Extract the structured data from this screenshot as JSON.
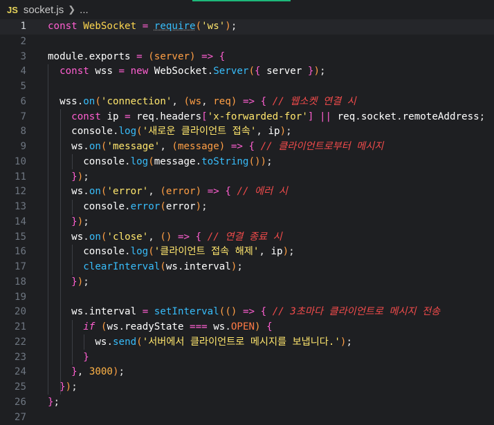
{
  "breadcrumb": {
    "lang_badge": "JS",
    "file": "socket.js",
    "tail": "..."
  },
  "lines": [
    {
      "n": "1"
    },
    {
      "n": "2"
    },
    {
      "n": "3"
    },
    {
      "n": "4"
    },
    {
      "n": "5"
    },
    {
      "n": "6"
    },
    {
      "n": "7"
    },
    {
      "n": "8"
    },
    {
      "n": "9"
    },
    {
      "n": "10"
    },
    {
      "n": "11"
    },
    {
      "n": "12"
    },
    {
      "n": "13"
    },
    {
      "n": "14"
    },
    {
      "n": "15"
    },
    {
      "n": "16"
    },
    {
      "n": "17"
    },
    {
      "n": "18"
    },
    {
      "n": "19"
    },
    {
      "n": "20"
    },
    {
      "n": "21"
    },
    {
      "n": "22"
    },
    {
      "n": "23"
    },
    {
      "n": "24"
    },
    {
      "n": "25"
    },
    {
      "n": "26"
    },
    {
      "n": "27"
    }
  ],
  "code": {
    "l1": {
      "kw": "const",
      "cls": "WebSocket",
      "eq": "=",
      "fn": "require",
      "str": "'ws'"
    },
    "l3": {
      "a": "module",
      "b": "exports",
      "eq": "=",
      "p": "server",
      "arrow": "=>"
    },
    "l4": {
      "kw": "const",
      "v": "wss",
      "eq": "=",
      "nw": "new",
      "cls": "WebSocket",
      "fn": "Server",
      "v2": "server"
    },
    "l6": {
      "v": "wss",
      "fn": "on",
      "str": "'connection'",
      "p1": "ws",
      "p2": "req",
      "arrow": "=>",
      "cm": "// 웹소켓 연결 시"
    },
    "l7": {
      "kw": "const",
      "v": "ip",
      "eq": "=",
      "a": "req",
      "b": "headers",
      "str": "'x-forwarded-for'",
      "or": "||",
      "c": "req",
      "d": "socket",
      "e": "remoteAddress"
    },
    "l8": {
      "a": "console",
      "fn": "log",
      "str": "'새로운 클라이언트 접속'",
      "v": "ip"
    },
    "l9": {
      "v": "ws",
      "fn": "on",
      "str": "'message'",
      "p": "message",
      "arrow": "=>",
      "cm": "// 클라이언트로부터 메시지"
    },
    "l10": {
      "a": "console",
      "fn": "log",
      "v": "message",
      "fn2": "toString"
    },
    "l12": {
      "v": "ws",
      "fn": "on",
      "str": "'error'",
      "p": "error",
      "arrow": "=>",
      "cm": "// 에러 시"
    },
    "l13": {
      "a": "console",
      "fn": "error",
      "v": "error"
    },
    "l15": {
      "v": "ws",
      "fn": "on",
      "str": "'close'",
      "arrow": "=>",
      "cm": "// 연결 종료 시"
    },
    "l16": {
      "a": "console",
      "fn": "log",
      "str": "'클라이언트 접속 해제'",
      "v": "ip"
    },
    "l17": {
      "fn": "clearInterval",
      "a": "ws",
      "b": "interval"
    },
    "l20": {
      "a": "ws",
      "b": "interval",
      "eq": "=",
      "fn": "setInterval",
      "arrow": "=>",
      "cm": "// 3초마다 클라이언트로 메시지 전송"
    },
    "l21": {
      "kw": "if",
      "a": "ws",
      "b": "readyState",
      "eq": "===",
      "c": "ws",
      "d": "OPEN"
    },
    "l22": {
      "a": "ws",
      "fn": "send",
      "str": "'서버에서 클라이언트로 메시지를 보냅니다.'"
    },
    "l24": {
      "num": "3000"
    }
  }
}
